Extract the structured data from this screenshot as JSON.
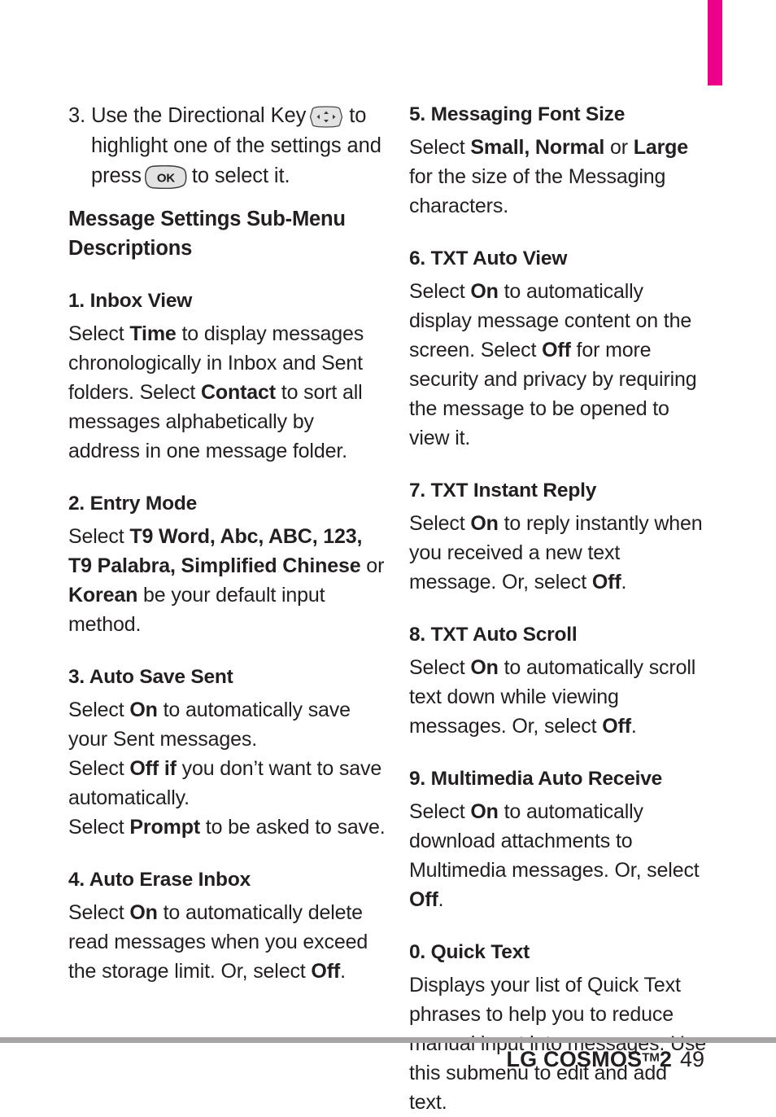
{
  "page": {
    "accent_color": "#ec0089",
    "rule_color": "#a7a5a6",
    "text_color": "#231f20"
  },
  "left_column": {
    "step": {
      "number": "3.",
      "text_before_dpad": "Use the Directional Key",
      "text_after_dpad": "to",
      "line2": "highlight one of the settings and",
      "line3_before_ok": "press",
      "line3_after_ok": "to select it.",
      "dpad_icon": "directional-key-icon",
      "ok_icon": "ok-key-icon"
    },
    "section_title": "Message Settings Sub-Menu Descriptions",
    "items": [
      {
        "title": "1. Inbox View",
        "body": "Select Time to display messages chronologically in Inbox and Sent folders. Select Contact to sort all messages alphabetically by address in one message folder.",
        "bold_terms": [
          "Time",
          "Contact"
        ]
      },
      {
        "title": "2. Entry Mode",
        "body": "Select T9 Word, Abc, ABC, 123, T9 Palabra, Simplified Chinese or Korean be your default input method.",
        "bold_terms": [
          "T9 Word, Abc, ABC, 123, T9 Palabra, Simplified Chinese",
          "Korean"
        ]
      },
      {
        "title": "3. Auto Save Sent",
        "body": "Select On to automatically save your Sent messages.\nSelect Off if you don’t want to save automatically.\nSelect Prompt to be asked to save.",
        "bold_terms": [
          "On",
          "Off if",
          "Prompt"
        ]
      },
      {
        "title": "4. Auto Erase Inbox",
        "body": "Select On to automatically delete read messages when you exceed the storage limit. Or, select Off.",
        "bold_terms": [
          "On",
          "Off"
        ]
      }
    ]
  },
  "right_column": {
    "items": [
      {
        "title": "5. Messaging Font Size",
        "body": "Select Small, Normal or Large for the size of the Messaging characters.",
        "bold_terms": [
          "Small, Normal",
          "Large"
        ]
      },
      {
        "title": "6. TXT Auto View",
        "body": "Select On to automatically display message content on the screen. Select Off for more security and privacy by requiring the message to be opened to view it.",
        "bold_terms": [
          "On",
          "Off"
        ]
      },
      {
        "title": "7. TXT Instant Reply",
        "body": "Select On to reply instantly when you received a new text message. Or, select Off.",
        "bold_terms": [
          "On",
          "Off"
        ]
      },
      {
        "title": "8. TXT Auto Scroll",
        "body": "Select On to automatically scroll text down while viewing messages. Or, select Off.",
        "bold_terms": [
          "On",
          "Off"
        ]
      },
      {
        "title": "9. Multimedia Auto Receive",
        "body": "Select On to automatically download attachments to Multimedia messages. Or, select Off.",
        "bold_terms": [
          "On",
          "Off"
        ]
      },
      {
        "title": "0. Quick Text",
        "body": "Displays your list of Quick Text phrases to help you to reduce manual input into messages. Use this submenu to edit and add text.",
        "bold_terms": []
      }
    ]
  },
  "footer": {
    "brand": "LG COSMOS",
    "trademark": "TM",
    "model": "2",
    "page_number": "49"
  }
}
